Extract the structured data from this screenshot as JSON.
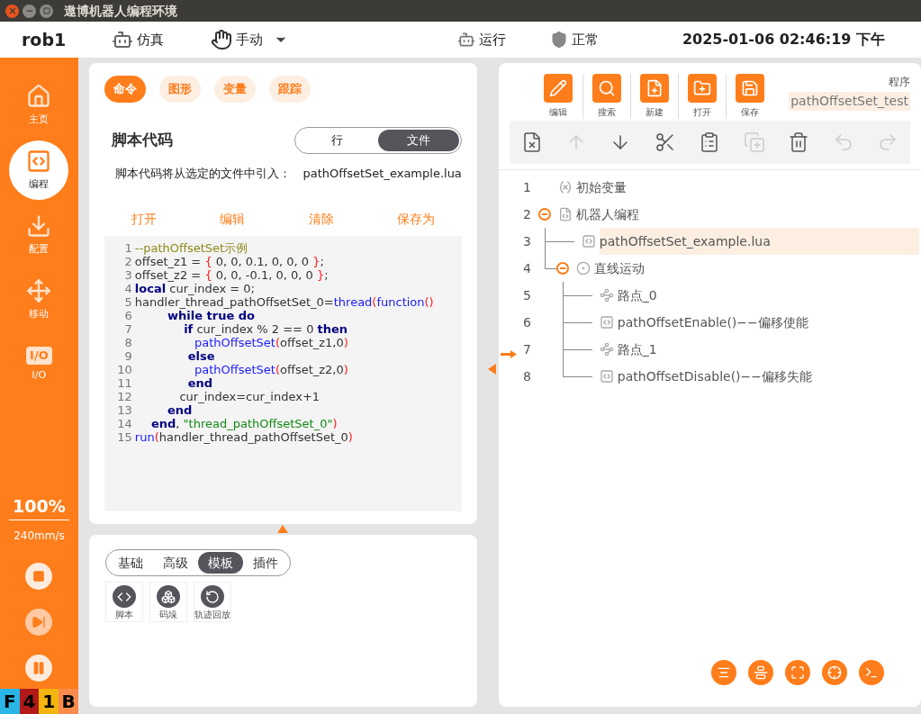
{
  "window": {
    "title": "遨博机器人编程环境"
  },
  "header": {
    "robot": "rob1",
    "mode": "仿真",
    "control": "手动",
    "run_state": "运行",
    "safety": "正常",
    "datetime": "2025-01-06 02:46:19 下午"
  },
  "sidebar": {
    "items": [
      {
        "kind": "home",
        "label": "主页",
        "selected": false
      },
      {
        "kind": "code",
        "label": "编程",
        "selected": true
      },
      {
        "kind": "config",
        "label": "配置",
        "selected": false
      },
      {
        "kind": "move",
        "label": "移动",
        "selected": false
      },
      {
        "kind": "io",
        "icon_text": "I/O",
        "label": "I/O",
        "selected": false
      }
    ],
    "speed": "100%",
    "speed_rate": "240mm/s",
    "controls": [
      {
        "kind": "stop",
        "disabled": false
      },
      {
        "kind": "step",
        "disabled": true
      },
      {
        "kind": "pause",
        "disabled": false
      }
    ],
    "status": [
      {
        "label": "F",
        "color": "#29b6e6"
      },
      {
        "label": "4",
        "color": "#b21a1a"
      },
      {
        "label": "1",
        "color": "#f5b50f"
      },
      {
        "label": "B",
        "color": "#f98b4c"
      }
    ]
  },
  "command_panel": {
    "tabs": [
      {
        "label": "命令",
        "selected": true
      },
      {
        "label": "图形",
        "selected": false
      },
      {
        "label": "变量",
        "selected": false
      },
      {
        "label": "跟踪",
        "selected": false
      }
    ],
    "title": "脚本代码",
    "mode_toggle": [
      {
        "label": "行",
        "selected": false
      },
      {
        "label": "文件",
        "selected": true
      }
    ],
    "import_label": "脚本代码将从选定的文件中引入：",
    "import_file": "pathOffsetSet_example.lua",
    "actions": [
      "打开",
      "编辑",
      "清除",
      "保存为"
    ],
    "code": [
      {
        "number": "1",
        "tokens": [
          {
            "kind": "comment",
            "text": "--pathOffsetSet示例"
          }
        ]
      },
      {
        "number": "2",
        "tokens": [
          {
            "kind": "plain",
            "text": "offset_z1 = "
          },
          {
            "kind": "paren",
            "text": "{"
          },
          {
            "kind": "plain",
            "text": " 0, 0, 0.1, 0, 0, 0 "
          },
          {
            "kind": "paren",
            "text": "}"
          },
          {
            "kind": "plain",
            "text": ";"
          }
        ]
      },
      {
        "number": "3",
        "tokens": [
          {
            "kind": "plain",
            "text": "offset_z2 = "
          },
          {
            "kind": "paren",
            "text": "{"
          },
          {
            "kind": "plain",
            "text": " 0, 0, -0.1, 0, 0, 0 "
          },
          {
            "kind": "paren",
            "text": "}"
          },
          {
            "kind": "plain",
            "text": ";"
          }
        ]
      },
      {
        "number": "4",
        "tokens": [
          {
            "kind": "keyword",
            "text": "local"
          },
          {
            "kind": "plain",
            "text": " cur_index = 0;"
          }
        ]
      },
      {
        "number": "5",
        "tokens": [
          {
            "kind": "plain",
            "text": "handler_thread_pathOffsetSet_0="
          },
          {
            "kind": "builtin",
            "text": "thread"
          },
          {
            "kind": "paren",
            "text": "("
          },
          {
            "kind": "builtin",
            "text": "function"
          },
          {
            "kind": "paren",
            "text": "()"
          }
        ]
      },
      {
        "number": "6",
        "tokens": [
          {
            "kind": "keyword",
            "text": "        while true do"
          }
        ]
      },
      {
        "number": "7",
        "tokens": [
          {
            "kind": "keyword",
            "text": "            if"
          },
          {
            "kind": "plain",
            "text": " cur_index % 2 == 0 "
          },
          {
            "kind": "keyword",
            "text": "then"
          }
        ]
      },
      {
        "number": "8",
        "tokens": [
          {
            "kind": "builtin",
            "text": "                pathOffsetSet"
          },
          {
            "kind": "paren",
            "text": "("
          },
          {
            "kind": "plain",
            "text": "offset_z1,0"
          },
          {
            "kind": "paren",
            "text": ")"
          }
        ]
      },
      {
        "number": "9",
        "tokens": [
          {
            "kind": "keyword",
            "text": "             else"
          }
        ]
      },
      {
        "number": "10",
        "tokens": [
          {
            "kind": "builtin",
            "text": "                pathOffsetSet"
          },
          {
            "kind": "paren",
            "text": "("
          },
          {
            "kind": "plain",
            "text": "offset_z2,0"
          },
          {
            "kind": "paren",
            "text": ")"
          }
        ]
      },
      {
        "number": "11",
        "tokens": [
          {
            "kind": "keyword",
            "text": "             end"
          }
        ]
      },
      {
        "number": "12",
        "tokens": [
          {
            "kind": "plain",
            "text": "            cur_index=cur_index+1"
          }
        ]
      },
      {
        "number": "13",
        "tokens": [
          {
            "kind": "keyword",
            "text": "        end"
          }
        ]
      },
      {
        "number": "14",
        "tokens": [
          {
            "kind": "keyword",
            "text": "    end"
          },
          {
            "kind": "plain",
            "text": ", "
          },
          {
            "kind": "string",
            "text": "\"thread_pathOffsetSet_0\""
          },
          {
            "kind": "paren",
            "text": ")"
          }
        ]
      },
      {
        "number": "15",
        "tokens": [
          {
            "kind": "builtin",
            "text": "run"
          },
          {
            "kind": "paren",
            "text": "("
          },
          {
            "kind": "plain",
            "text": "handler_thread_pathOffsetSet_0"
          },
          {
            "kind": "paren",
            "text": ")"
          }
        ]
      }
    ]
  },
  "template_panel": {
    "tabs": [
      {
        "label": "基础",
        "selected": false
      },
      {
        "label": "高级",
        "selected": false
      },
      {
        "label": "模板",
        "selected": true
      },
      {
        "label": "插件",
        "selected": false
      }
    ],
    "items": [
      {
        "kind": "script",
        "label": "脚本"
      },
      {
        "kind": "pallet",
        "label": "码垛"
      },
      {
        "kind": "replay",
        "label": "轨迹回放"
      }
    ]
  },
  "program_panel": {
    "toolbar": [
      {
        "kind": "edit",
        "label": "编辑"
      },
      {
        "kind": "search",
        "label": "搜索"
      },
      {
        "kind": "new",
        "label": "新建"
      },
      {
        "kind": "open",
        "label": "打开"
      },
      {
        "kind": "save",
        "label": "保存"
      }
    ],
    "program_label": "程序",
    "program_name": "pathOffsetSet_test",
    "edit_tools": [
      {
        "kind": "clear",
        "disabled": false
      },
      {
        "kind": "up",
        "disabled": true
      },
      {
        "kind": "down",
        "disabled": false
      },
      {
        "kind": "cut",
        "disabled": false
      },
      {
        "kind": "paste",
        "disabled": false
      },
      {
        "kind": "duplicate",
        "disabled": true
      },
      {
        "kind": "delete",
        "disabled": false
      },
      {
        "kind": "undo",
        "disabled": true
      },
      {
        "kind": "redo",
        "disabled": true
      }
    ],
    "tree": [
      {
        "number": "1",
        "kind": "variables",
        "label": "初始变量",
        "selected": false,
        "current": false
      },
      {
        "number": "2",
        "kind": "program",
        "label": "机器人编程",
        "selected": false,
        "current": false,
        "expanded": true,
        "children": [
          {
            "number": "3",
            "kind": "script",
            "label": "pathOffsetSet_example.lua",
            "selected": true,
            "current": false
          },
          {
            "number": "4",
            "kind": "linear",
            "label": "直线运动",
            "selected": false,
            "current": false,
            "expanded": true,
            "children": [
              {
                "number": "5",
                "kind": "waypoint",
                "label": "路点_0",
                "selected": false,
                "current": false
              },
              {
                "number": "6",
                "kind": "script",
                "label": "pathOffsetEnable()−−偏移使能",
                "selected": false,
                "current": false
              },
              {
                "number": "7",
                "kind": "waypoint",
                "label": "路点_1",
                "selected": false,
                "current": true
              },
              {
                "number": "8",
                "kind": "script",
                "label": "pathOffsetDisable()−−偏移失能",
                "selected": false,
                "current": false
              }
            ]
          }
        ]
      }
    ],
    "view_tools": [
      {
        "kind": "center"
      },
      {
        "kind": "align"
      },
      {
        "kind": "fit"
      },
      {
        "kind": "target"
      },
      {
        "kind": "terminal"
      }
    ]
  }
}
